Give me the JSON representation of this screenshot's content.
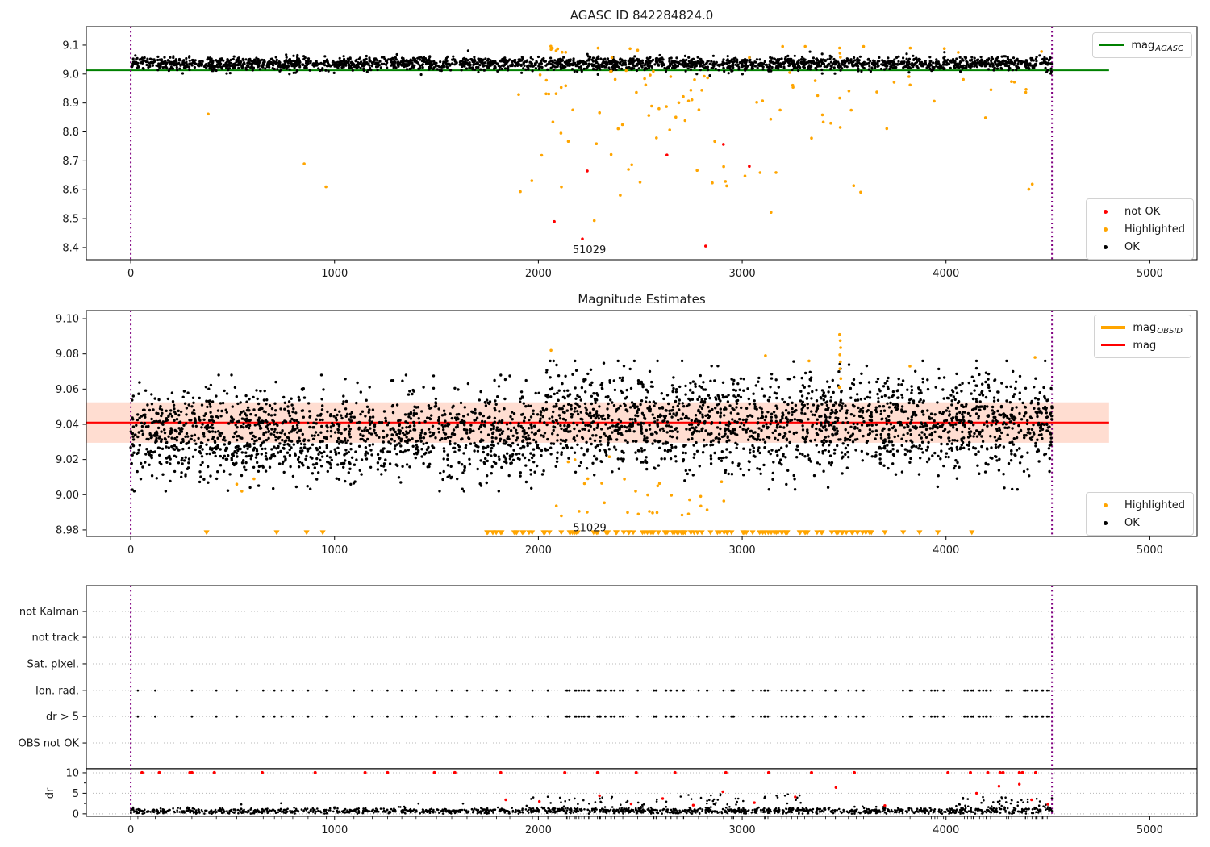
{
  "chart_data": [
    {
      "type": "scatter",
      "title": "AGASC ID 842284824.0",
      "xlim": [
        -218,
        5232
      ],
      "ylim": [
        8.358,
        9.164
      ],
      "xticks": [
        0,
        1000,
        2000,
        3000,
        4000,
        5000
      ],
      "xtick_labels": [
        "0",
        "1000",
        "2000",
        "3000",
        "4000",
        "5000"
      ],
      "yticks": [
        8.4,
        8.5,
        8.6,
        8.7,
        8.8,
        8.9,
        9.0,
        9.1
      ],
      "ytick_labels": [
        "8.4",
        "8.5",
        "8.6",
        "8.7",
        "8.8",
        "8.9",
        "9.0",
        "9.1"
      ],
      "grid": false,
      "hlines": [
        {
          "y": 9.013,
          "x0": -218,
          "x1": 4800,
          "color": "#008000",
          "width": 2,
          "name": "mag-agasc-line"
        }
      ],
      "vlines": [
        {
          "x": 0,
          "color": "#800080"
        },
        {
          "x": 4520,
          "color": "#800080"
        }
      ],
      "legend_top": {
        "position": "upper right",
        "entries": [
          {
            "label_main": "mag",
            "label_sub": "AGASC",
            "color": "#008000",
            "sample": "line",
            "lw": 2.5
          }
        ]
      },
      "legend_bottom": {
        "position": "lower right",
        "entries": [
          {
            "label": "not OK",
            "color": "#ff0000",
            "sample": "dot"
          },
          {
            "label": "Highlighted",
            "color": "#ffa500",
            "sample": "dot"
          },
          {
            "label": "OK",
            "color": "#000000",
            "sample": "dot"
          }
        ]
      },
      "annotation": {
        "text": "51029",
        "x": 2250,
        "y": 8.392
      },
      "series": {
        "ok": {
          "color": "#000000",
          "clusters": [
            {
              "n": 2400,
              "x": [
                0,
                4520
              ],
              "mean": 9.036,
              "std": 0.0115,
              "clip": [
                8.995,
                9.085
              ]
            }
          ]
        },
        "highlighted": {
          "color": "#ffa500",
          "clusters": [
            {
              "n": 72,
              "x": [
                1900,
                3350
              ],
              "y": [
                8.43,
                9.015
              ],
              "bias": "high"
            },
            {
              "n": 26,
              "x": [
                3350,
                4430
              ],
              "y": [
                8.55,
                9.03
              ],
              "bias": "high"
            },
            {
              "n": 16,
              "x": [
                1900,
                4520
              ],
              "y": [
                9.05,
                9.098
              ]
            }
          ],
          "points": [
            [
              380,
              8.862
            ],
            [
              851,
              8.69
            ],
            [
              958,
              8.61
            ],
            [
              2450,
              9.088
            ],
            [
              3478,
              9.09
            ],
            [
              3480,
              9.072
            ],
            [
              3482,
              9.058
            ],
            [
              4060,
              9.075
            ],
            [
              2062,
              9.085
            ]
          ]
        },
        "not_ok": {
          "color": "#ff0000",
          "points": [
            [
              2078,
              8.49
            ],
            [
              2216,
              8.43
            ],
            [
              2240,
              8.665
            ],
            [
              2631,
              8.72
            ],
            [
              2821,
              8.405
            ],
            [
              2908,
              8.757
            ],
            [
              3035,
              8.681
            ]
          ]
        }
      }
    },
    {
      "type": "scatter",
      "title": "Magnitude Estimates",
      "xlim": [
        -218,
        5232
      ],
      "ylim": [
        8.9763,
        9.1046
      ],
      "xticks": [
        0,
        1000,
        2000,
        3000,
        4000,
        5000
      ],
      "xtick_labels": [
        "0",
        "1000",
        "2000",
        "3000",
        "4000",
        "5000"
      ],
      "yticks": [
        8.98,
        9.0,
        9.02,
        9.04,
        9.06,
        9.08,
        9.1
      ],
      "ytick_labels": [
        "8.98",
        "9.00",
        "9.02",
        "9.04",
        "9.06",
        "9.08",
        "9.10"
      ],
      "grid": false,
      "band": {
        "y0": 9.0295,
        "y1": 9.0525,
        "x0": -218,
        "x1": 4800,
        "color": "rgba(255,69,0,0.18)"
      },
      "hlines": [
        {
          "y": 9.041,
          "x0": -218,
          "x1": 4800,
          "color": "#ff0000",
          "width": 2.2,
          "name": "mag-line"
        }
      ],
      "vlines": [
        {
          "x": 0,
          "color": "#800080"
        },
        {
          "x": 4520,
          "color": "#800080"
        }
      ],
      "legend_top": {
        "position": "upper right",
        "entries": [
          {
            "label_main": "mag",
            "label_sub": "OBSID",
            "color": "#ffa500",
            "sample": "line",
            "lw": 4
          },
          {
            "label_main": "mag",
            "label_sub": "",
            "color": "#ff0000",
            "sample": "line",
            "lw": 2.5
          }
        ]
      },
      "legend_bottom": {
        "position": "lower right",
        "entries": [
          {
            "label": "Highlighted",
            "color": "#ffa500",
            "sample": "dot"
          },
          {
            "label": "OK",
            "color": "#000000",
            "sample": "dot"
          }
        ]
      },
      "annotation": {
        "text": "51029",
        "x": 2252,
        "y": 8.9812
      },
      "series": {
        "ok": {
          "color": "#000000",
          "clusters": [
            {
              "n": 1450,
              "x": [
                0,
                2000
              ],
              "mean": 9.034,
              "std": 0.0125,
              "clip": [
                9.002,
                9.068
              ]
            },
            {
              "n": 1900,
              "x": [
                2000,
                4520
              ],
              "mean": 9.0415,
              "std": 0.0135,
              "clip": [
                9.003,
                9.076
              ]
            }
          ]
        },
        "highlighted": {
          "color": "#ffa500",
          "clusters": [
            {
              "n": 30,
              "x": [
                2050,
                2950
              ],
              "y": [
                8.988,
                9.028
              ],
              "bias": "low"
            }
          ],
          "points": [
            [
              3478,
              9.091
            ],
            [
              3481,
              9.0875
            ],
            [
              3483,
              9.0835
            ],
            [
              3479,
              9.0795
            ],
            [
              3482,
              9.0755
            ],
            [
              3480,
              9.0715
            ],
            [
              3484,
              9.066
            ],
            [
              3477,
              9.061
            ],
            [
              3114,
              9.079
            ],
            [
              3328,
              9.076
            ],
            [
              3823,
              9.073
            ],
            [
              4437,
              9.078
            ],
            [
              2062,
              9.082
            ],
            [
              520,
              9.006
            ],
            [
              545,
              9.002
            ],
            [
              605,
              9.009
            ]
          ]
        },
        "triangles": {
          "color": "#ffa500",
          "y": 8.9785,
          "xs": [
            372,
            716,
            863,
            942,
            3700,
            3790,
            3870,
            3960,
            4127
          ],
          "clusters": [
            {
              "n": 112,
              "x": [
                1740,
                3640
              ]
            }
          ]
        }
      }
    },
    {
      "type": "flags_dr",
      "title": "",
      "categories": [
        "not Kalman",
        "not track",
        "Sat. pixel.",
        "Ion. rad.",
        "dr > 5",
        "OBS not OK"
      ],
      "ylabel": "dr",
      "dr_ticks": [
        10,
        5,
        0
      ],
      "dr_tick_labels": [
        "10",
        "5",
        "0"
      ],
      "xlim": [
        -218,
        5232
      ],
      "xticks": [
        0,
        1000,
        2000,
        3000,
        4000,
        5000
      ],
      "xtick_labels": [
        "0",
        "1000",
        "2000",
        "3000",
        "4000",
        "5000"
      ],
      "grid": true,
      "vlines": [
        {
          "x": 0,
          "color": "#800080"
        },
        {
          "x": 4520,
          "color": "#800080"
        }
      ],
      "flag_rows_with_points": [
        "Ion. rad.",
        "dr > 5"
      ],
      "flag_xs_sparse": [
        35,
        120,
        300,
        420,
        520,
        650,
        705,
        740,
        795,
        870,
        960,
        1095,
        1185,
        1260,
        1330,
        1400,
        1500,
        1575,
        1650,
        1725,
        1795,
        1860
      ],
      "flag_clusters": [
        {
          "n": 24,
          "x": [
            1950,
            2430
          ]
        },
        {
          "n": 20,
          "x": [
            2460,
            3060
          ]
        },
        {
          "n": 18,
          "x": [
            3080,
            3650
          ]
        },
        {
          "n": 8,
          "x": [
            3700,
            3990
          ]
        },
        {
          "n": 26,
          "x": [
            4040,
            4510
          ]
        }
      ],
      "dr_ok": {
        "color": "#000000",
        "clusters": [
          {
            "n": 1350,
            "x": [
              0,
              4520
            ],
            "mean": 0.7,
            "std": 0.35,
            "abs": true,
            "clip": [
              0.05,
              2.1
            ]
          },
          {
            "n": 120,
            "x": [
              1950,
              3350
            ],
            "y": [
              0.9,
              4.8
            ],
            "bias": "low"
          },
          {
            "n": 65,
            "x": [
              4050,
              4520
            ],
            "y": [
              0.9,
              4.2
            ],
            "bias": "low"
          },
          {
            "n": 10,
            "x": [
              300,
              1950
            ],
            "y": [
              1.2,
              2.7
            ]
          }
        ]
      },
      "dr_clip_value": 10,
      "dr_red_clipped_xs": [
        55,
        140,
        290,
        300,
        410,
        645,
        905,
        1150,
        1260,
        1490,
        1590,
        1815,
        2130,
        2290,
        2480,
        2670,
        2920,
        3130,
        3340,
        3550,
        4010,
        4120,
        4205,
        4265,
        4280,
        4360,
        4375,
        4440
      ],
      "dr_red_points": [
        [
          1840,
          3.4
        ],
        [
          2005,
          3.0
        ],
        [
          2300,
          4.4
        ],
        [
          2455,
          2.4
        ],
        [
          2610,
          3.7
        ],
        [
          2760,
          2.1
        ],
        [
          2905,
          5.4
        ],
        [
          3060,
          2.7
        ],
        [
          3260,
          4.1
        ],
        [
          3460,
          6.4
        ],
        [
          4150,
          5.0
        ],
        [
          4260,
          6.7
        ],
        [
          4420,
          3.4
        ],
        [
          4500,
          2.3
        ],
        [
          4360,
          7.2
        ],
        [
          3700,
          2.0
        ]
      ],
      "red_color": "#ff0000",
      "separator_dr": 11
    }
  ],
  "colors": {
    "ok": "#000000",
    "not_ok": "#ff0000",
    "highlighted": "#ffa500",
    "mag_agasc_line": "#008000",
    "mag_line": "#ff0000",
    "band": "rgba(255,69,0,0.18)",
    "obsid_vline": "#800080",
    "grid": "#b8b8b8",
    "text": "#1a1a1a"
  }
}
